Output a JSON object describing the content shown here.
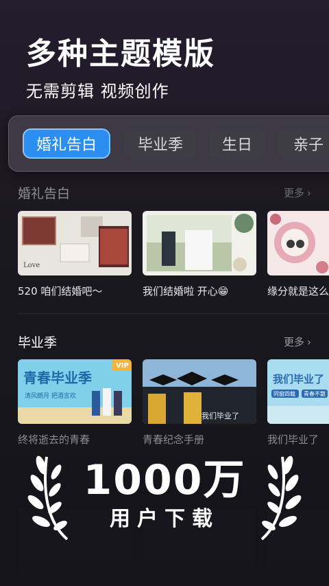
{
  "hero": {
    "title": "多种主题模版",
    "subtitle": "无需剪辑 视频创作"
  },
  "tabs": [
    {
      "label": "婚礼告白",
      "active": true
    },
    {
      "label": "毕业季",
      "active": false
    },
    {
      "label": "生日",
      "active": false
    },
    {
      "label": "亲子",
      "active": false
    }
  ],
  "sections": [
    {
      "title": "婚礼告白",
      "more": "更多",
      "cards": [
        "520 咱们结婚吧～",
        "我们结婚啦 开心😁",
        "缘分就是这么"
      ]
    },
    {
      "title": "毕业季",
      "more": "更多",
      "cards": [
        "终将逝去的青春",
        "青春纪念手册",
        "我们毕业了"
      ]
    }
  ],
  "thumb_text": {
    "love": "Love",
    "youth_title": "青春毕业季",
    "youth_sub": "清风朗月 把酒言欢",
    "vip": "VIP",
    "grad_title": "我们毕业了",
    "grad_tag1": "同窗四载",
    "grad_tag2": "青春不散",
    "grad_script": "我们毕业了"
  },
  "promo": {
    "number": "1000万",
    "caption": "用户下载"
  },
  "colors": {
    "accent": "#2b8ef0",
    "background": "#1a1820"
  }
}
